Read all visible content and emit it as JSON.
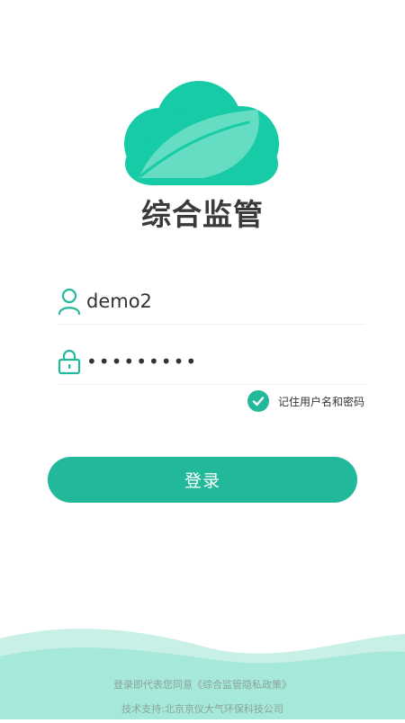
{
  "app": {
    "title": "综合监管"
  },
  "login_form": {
    "username": {
      "icon": "user-icon",
      "value": "demo2"
    },
    "password": {
      "icon": "lock-icon",
      "masked_value": "•••••••••"
    },
    "remember": {
      "label": "记住用户名和密码",
      "checked": true
    },
    "submit_label": "登录"
  },
  "footer": {
    "agree_prefix": "登录即代表您同意",
    "policy_link": "《综合监管隐私政策》",
    "support": "技术支持:北京京仪大气环保科技公司"
  },
  "colors": {
    "accent": "#22b99a",
    "logo_green": "#1dcaa5",
    "wave_light": "#b6ece0"
  }
}
